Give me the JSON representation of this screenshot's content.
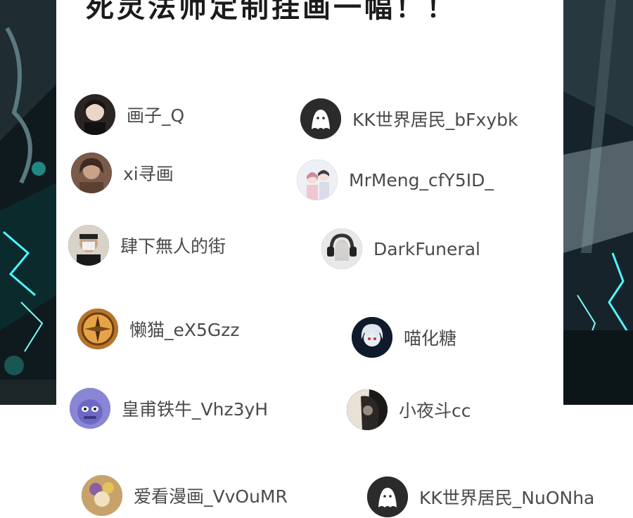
{
  "headline": "死灵法师定制挂画一幅！！",
  "users": [
    {
      "name": "画子_Q",
      "avatar": "dark-hair-boy-avatar"
    },
    {
      "name": "KK世界居民_bFxybk",
      "avatar": "default-ghost-avatar"
    },
    {
      "name": "xi寻画",
      "avatar": "sepia-portrait-avatar"
    },
    {
      "name": "MrMeng_cfY5ID_",
      "avatar": "couple-illustration-avatar"
    },
    {
      "name": "肆下無人的街",
      "avatar": "masked-person-avatar"
    },
    {
      "name": "DarkFuneral",
      "avatar": "headphones-girl-avatar"
    },
    {
      "name": "懒猫_eX5Gzz",
      "avatar": "compass-avatar"
    },
    {
      "name": "喵化糖",
      "avatar": "white-hair-anime-avatar"
    },
    {
      "name": "皇甫铁牛_Vhz3yH",
      "avatar": "purple-monster-avatar"
    },
    {
      "name": "小夜斗cc",
      "avatar": "shadow-girl-avatar"
    },
    {
      "name": "爱看漫画_VvOuMR",
      "avatar": "floral-avatar"
    },
    {
      "name": "KK世界居民_NuONha",
      "avatar": "default-ghost-avatar"
    }
  ]
}
